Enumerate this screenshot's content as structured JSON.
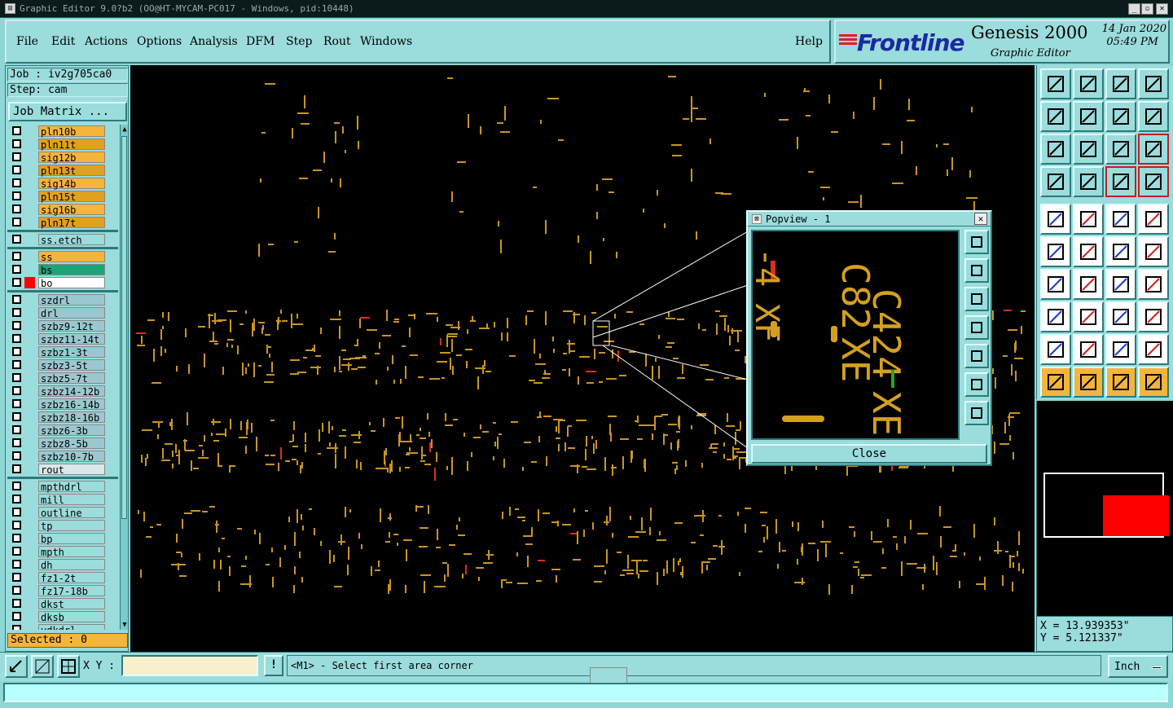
{
  "window": {
    "title": "Graphic Editor 9.0?b2 (OO@HT-MYCAM-PC017 - Windows, pid:10448)"
  },
  "menu": {
    "items": [
      "File",
      "Edit",
      "Actions",
      "Options",
      "Analysis",
      "DFM",
      "Step",
      "Rout",
      "Windows"
    ],
    "help": "Help"
  },
  "brand": {
    "logo": "Frontline",
    "product": "Genesis 2000",
    "subtitle": "Graphic Editor",
    "date": "14 Jan 2020",
    "time": "05:49 PM"
  },
  "left": {
    "job": "Job : iv2g705ca0",
    "step": "Step: cam",
    "job_matrix": "Job Matrix ...",
    "selected": "Selected : 0",
    "layers": [
      {
        "name": "pln10b",
        "color": "#f5b43a",
        "group": 1
      },
      {
        "name": "pln11t",
        "color": "#e0a020",
        "group": 1
      },
      {
        "name": "sig12b",
        "color": "#f5b43a",
        "group": 1
      },
      {
        "name": "pln13t",
        "color": "#e0a020",
        "group": 1
      },
      {
        "name": "sig14b",
        "color": "#f5b43a",
        "group": 1
      },
      {
        "name": "pln15t",
        "color": "#e0a020",
        "group": 1
      },
      {
        "name": "sig16b",
        "color": "#f5b43a",
        "group": 1
      },
      {
        "name": "pln17t",
        "color": "#e0a020",
        "group": 1
      },
      {
        "name": "ss.etch",
        "color": "#9bdcdc",
        "group": 2
      },
      {
        "name": "ss",
        "color": "#f5b43a",
        "group": 3
      },
      {
        "name": "bs",
        "color": "#1ba37a",
        "group": 3
      },
      {
        "name": "bo",
        "color": "#ffffff",
        "group": 3,
        "selected_color": "#ff0000"
      },
      {
        "name": "szdrl",
        "color": "#9bc8d0",
        "group": 4
      },
      {
        "name": "drl",
        "color": "#9bc8d0",
        "group": 4
      },
      {
        "name": "szbz9-12t",
        "color": "#9bc8d0",
        "group": 4
      },
      {
        "name": "szbz11-14t",
        "color": "#9bc8d0",
        "group": 4
      },
      {
        "name": "szbz1-3t",
        "color": "#9bc8d0",
        "group": 4
      },
      {
        "name": "szbz3-5t",
        "color": "#9bc8d0",
        "group": 4
      },
      {
        "name": "szbz5-7t",
        "color": "#9bc8d0",
        "group": 4
      },
      {
        "name": "szbz14-12b",
        "color": "#9bc8d0",
        "group": 4
      },
      {
        "name": "szbz16-14b",
        "color": "#9bc8d0",
        "group": 4
      },
      {
        "name": "szbz18-16b",
        "color": "#9bc8d0",
        "group": 4
      },
      {
        "name": "szbz6-3b",
        "color": "#9bc8d0",
        "group": 4
      },
      {
        "name": "szbz8-5b",
        "color": "#9bc8d0",
        "group": 4
      },
      {
        "name": "szbz10-7b",
        "color": "#9bc8d0",
        "group": 4
      },
      {
        "name": "rout",
        "color": "#d8e8ec",
        "group": 4
      },
      {
        "name": "mpthdrl",
        "color": "#9bdcdc",
        "group": 5
      },
      {
        "name": "mill",
        "color": "#9bdcdc",
        "group": 5
      },
      {
        "name": "outline",
        "color": "#9bdcdc",
        "group": 5
      },
      {
        "name": "tp",
        "color": "#9bdcdc",
        "group": 5
      },
      {
        "name": "bp",
        "color": "#9bdcdc",
        "group": 5
      },
      {
        "name": "mpth",
        "color": "#9bdcdc",
        "group": 5
      },
      {
        "name": "dh",
        "color": "#9bdcdc",
        "group": 5
      },
      {
        "name": "fz1-2t",
        "color": "#9bdcdc",
        "group": 5
      },
      {
        "name": "fz17-18b",
        "color": "#9bdcdc",
        "group": 5
      },
      {
        "name": "dkst",
        "color": "#9bdcdc",
        "group": 5
      },
      {
        "name": "dksb",
        "color": "#9bdcdc",
        "group": 5
      },
      {
        "name": "vdkdrl",
        "color": "#9bdcdc",
        "group": 5
      }
    ]
  },
  "popview": {
    "title": "Popview - 1",
    "close_label": "Close",
    "labels": [
      "C82",
      "C424",
      "XE",
      "XE"
    ]
  },
  "coords": {
    "x": "X = 13.939353\"",
    "y": "Y = 5.121337\""
  },
  "bottom": {
    "xy_label": "X Y :",
    "xy_value": "",
    "bang": "!",
    "prompt": "<M1> - Select first area corner",
    "unit": "Inch"
  },
  "colors": {
    "panel": "#9bdcdc",
    "trace": "#d4a020",
    "highlight_red": "#ff0000"
  }
}
